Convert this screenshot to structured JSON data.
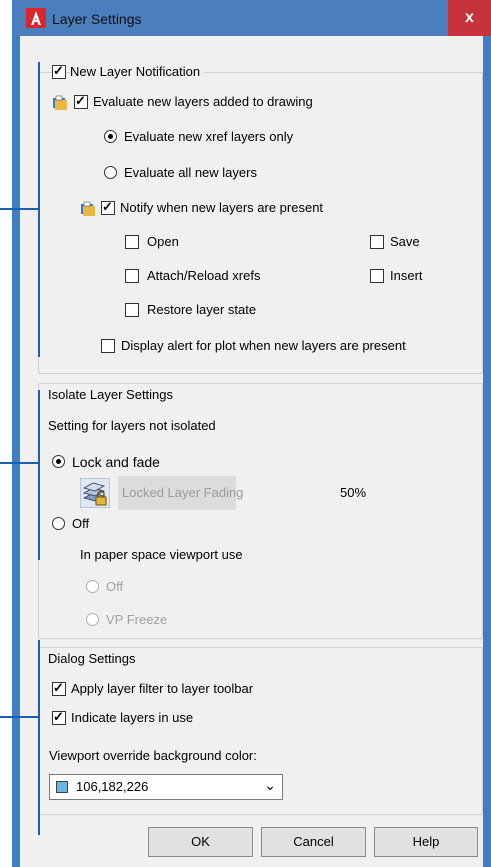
{
  "window": {
    "title": "Layer Settings",
    "close_label": "x"
  },
  "new_layer_notification": {
    "label": "New Layer Notification",
    "evaluate_new": {
      "label": "Evaluate new layers added to drawing"
    },
    "evaluate_xref_only": {
      "label": "Evaluate new xref layers only"
    },
    "evaluate_all": {
      "label": "Evaluate all new layers"
    },
    "notify_present": {
      "label": "Notify when new layers are present"
    },
    "open": {
      "label": "Open"
    },
    "save": {
      "label": "Save"
    },
    "attach_reload": {
      "label": "Attach/Reload xrefs"
    },
    "insert": {
      "label": "Insert"
    },
    "restore_state": {
      "label": "Restore layer state"
    },
    "display_alert": {
      "label": "Display alert for plot when new layers are present"
    }
  },
  "isolate": {
    "title": "Isolate Layer Settings",
    "subtitle": "Setting for layers not isolated",
    "lock_fade": {
      "label": "Lock and fade"
    },
    "fading_label": "Locked Layer Fading",
    "fading_value": "50%",
    "off": {
      "label": "Off"
    },
    "paper_space_label": "In paper space viewport use",
    "ps_off": {
      "label": "Off"
    },
    "ps_vp_freeze": {
      "label": "VP Freeze"
    }
  },
  "dialog_settings": {
    "title": "Dialog Settings",
    "apply_filter": {
      "label": "Apply layer filter to layer toolbar"
    },
    "indicate_in_use": {
      "label": "Indicate layers in use"
    },
    "viewport_override_label": "Viewport override background color:",
    "viewport_color_value": "106,182,226",
    "viewport_color_hex": "#6ab6e2"
  },
  "buttons": {
    "ok": "OK",
    "cancel": "Cancel",
    "help": "Help"
  },
  "colors": {
    "accent_blue": "#1a5fb4",
    "title_bar": "#4a7ebd",
    "close_red": "#c7333a"
  }
}
